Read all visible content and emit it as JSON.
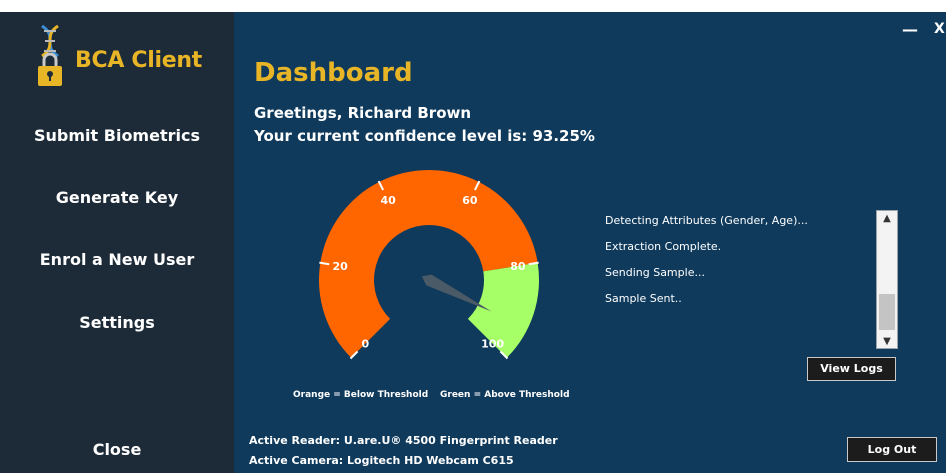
{
  "app": {
    "brand": "BCA Client"
  },
  "sidebar": {
    "items": [
      {
        "label": "Submit Biometrics"
      },
      {
        "label": "Generate Key"
      },
      {
        "label": "Enrol a New User"
      },
      {
        "label": "Settings"
      }
    ],
    "close_label": "Close"
  },
  "window_controls": {
    "minimize": "—",
    "close": "X"
  },
  "dashboard": {
    "title": "Dashboard",
    "greeting": "Greetings, Richard Brown",
    "confidence_text": "Your current confidence level is:  93.25%",
    "confidence_value": 93.25
  },
  "gauge": {
    "min": 0,
    "max": 100,
    "threshold": 80,
    "value": 93.25,
    "tick_labels": [
      "0",
      "20",
      "40",
      "60",
      "80",
      "100"
    ],
    "colors": {
      "below": "#ff6600",
      "above": "#a6ff66",
      "needle": "#4a5a66"
    },
    "legend_below": "Orange = Below Threshold",
    "legend_above": "Green = Above Threshold"
  },
  "log": {
    "lines": [
      "Detecting Attributes (Gender, Age)...",
      "Extraction Complete.",
      "Sending Sample...",
      "Sample Sent.."
    ],
    "view_logs_label": "View Logs"
  },
  "status": {
    "reader_text": "Active Reader:  U.are.U® 4500 Fingerprint Reader",
    "camera_text": "Active Camera:  Logitech HD Webcam C615"
  },
  "logout_label": "Log Out",
  "icons": {
    "brand": "dna-padlock-icon"
  }
}
